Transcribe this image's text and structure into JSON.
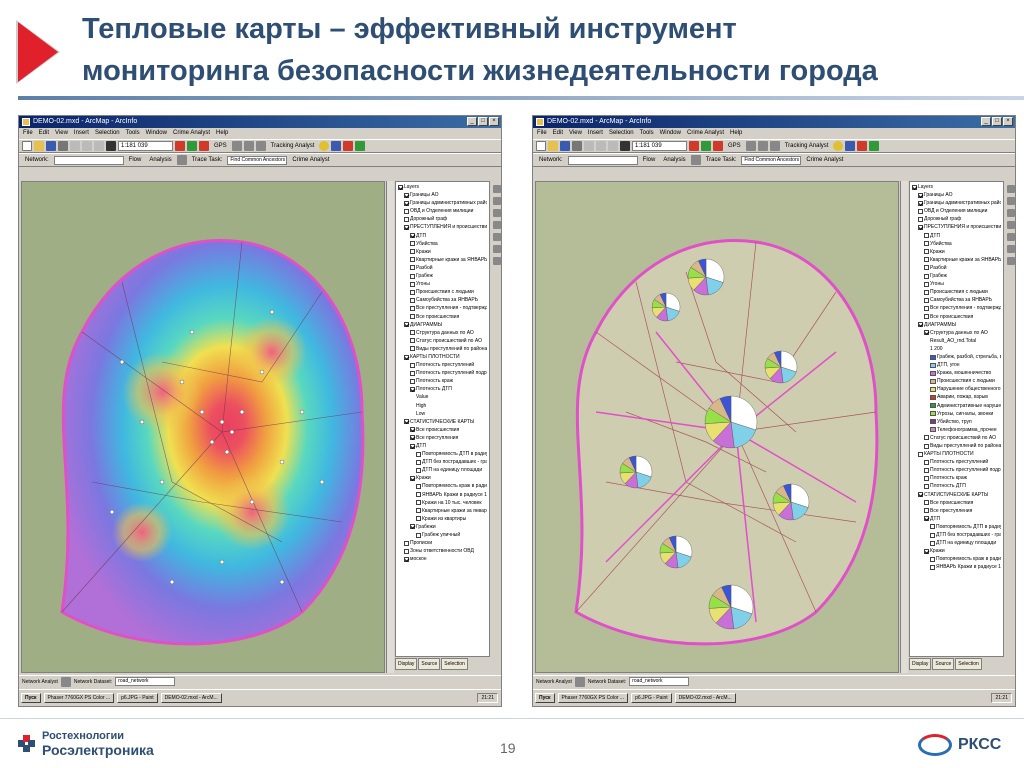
{
  "slide": {
    "title_line1": "Тепловые карты – эффективный инструмент",
    "title_line2": "мониторинга безопасности жизнедеятельности города",
    "page_number": "19",
    "logo_left_line1": "Ростехнологии",
    "logo_left_line2": "Росэлектроника",
    "logo_right": "РКСС"
  },
  "window": {
    "title": "DEMO-02.mxd - ArcMap - ArcInfo",
    "menu": [
      "File",
      "Edit",
      "View",
      "Insert",
      "Selection",
      "Tools",
      "Window",
      "Crime Analyst",
      "Help"
    ],
    "scale": "1:181 039",
    "gps_label": "GPS",
    "tracking_analyst": "Tracking Analyst",
    "network_label": "Network:",
    "flow_label": "Flow",
    "analysis_label": "Analysis",
    "trace_task_label": "Trace Task:",
    "trace_task_value": "Find Common Ancestors",
    "crime_analyst": "Crime Analyst",
    "network_analyst": "Network Analyst",
    "network_dataset_label": "Network Dataset:",
    "network_dataset_value": "road_network",
    "toc_tabs": [
      "Display",
      "Source",
      "Selection"
    ],
    "taskbar": {
      "start": "Пуск",
      "tasks_left": [
        "Phaser 7760GX PS Color ...",
        "p6.JPG - Paint",
        "DEMO-02.mxd - ArcM..."
      ],
      "tasks_right": [
        "Phaser 7760GX PS Color ...",
        "p6.JPG - Paint",
        "DEMO-02.mxd - ArcM..."
      ],
      "clock": "21:21"
    }
  },
  "toc_left": [
    {
      "t": "Layers",
      "lvl": 0,
      "c": true
    },
    {
      "t": "Границы АО",
      "lvl": 1,
      "c": true
    },
    {
      "t": "Границы административных районов",
      "lvl": 1,
      "c": true
    },
    {
      "t": "ОВД и Отделения милиции",
      "lvl": 1,
      "c": false
    },
    {
      "t": "Дорожный граф",
      "lvl": 1,
      "c": false
    },
    {
      "t": "ПРЕСТУПЛЕНИЯ и происшествия",
      "lvl": 1,
      "c": true
    },
    {
      "t": "ДТП",
      "lvl": 2,
      "c": true
    },
    {
      "t": "Убийства",
      "lvl": 2,
      "c": false
    },
    {
      "t": "Кражи",
      "lvl": 2,
      "c": false
    },
    {
      "t": "Квартирные кражи за ЯНВАРЬ",
      "lvl": 2,
      "c": false
    },
    {
      "t": "Разбой",
      "lvl": 2,
      "c": false
    },
    {
      "t": "Грабеж",
      "lvl": 2,
      "c": false
    },
    {
      "t": "Угоны",
      "lvl": 2,
      "c": false
    },
    {
      "t": "Происшествия с людьми",
      "lvl": 2,
      "c": false
    },
    {
      "t": "Самоубийства за ЯНВАРЬ",
      "lvl": 2,
      "c": false
    },
    {
      "t": "Все преступления - подтвержденные",
      "lvl": 2,
      "c": false
    },
    {
      "t": "Все происшествия",
      "lvl": 2,
      "c": false
    },
    {
      "t": "ДИАГРАММЫ",
      "lvl": 1,
      "c": true
    },
    {
      "t": "Структура данных по АО",
      "lvl": 2,
      "c": false
    },
    {
      "t": "Статус происшествий по АО",
      "lvl": 2,
      "c": false
    },
    {
      "t": "Виды преступлений по районам",
      "lvl": 2,
      "c": false
    },
    {
      "t": "КАРТЫ ПЛОТНОСТИ",
      "lvl": 1,
      "c": true
    },
    {
      "t": "Плотность преступлений",
      "lvl": 2,
      "c": false
    },
    {
      "t": "Плотность преступлений подробная",
      "lvl": 2,
      "c": false
    },
    {
      "t": "Плотность краж",
      "lvl": 2,
      "c": false
    },
    {
      "t": "Плотность ДТП",
      "lvl": 2,
      "c": true
    },
    {
      "t": "Value",
      "lvl": 3,
      "c": null
    },
    {
      "t": "High",
      "lvl": 3,
      "c": null
    },
    {
      "t": "",
      "lvl": 3,
      "c": null
    },
    {
      "t": "Low",
      "lvl": 3,
      "c": null
    },
    {
      "t": "СТАТИСТИЧЕСКИЕ КАРТЫ",
      "lvl": 1,
      "c": true
    },
    {
      "t": "Все происшествия",
      "lvl": 2,
      "c": true
    },
    {
      "t": "Все преступления",
      "lvl": 2,
      "c": true
    },
    {
      "t": "ДТП",
      "lvl": 2,
      "c": true
    },
    {
      "t": "Повторяемость ДТП в радиусе 100",
      "lvl": 3,
      "c": false
    },
    {
      "t": "ДТП без пострадавших - градуир...",
      "lvl": 3,
      "c": false
    },
    {
      "t": "ДТП на единицу площади",
      "lvl": 3,
      "c": false
    },
    {
      "t": "Кражи",
      "lvl": 2,
      "c": true
    },
    {
      "t": "Повторяемость краж в радиусе 10",
      "lvl": 3,
      "c": false
    },
    {
      "t": "ЯНВАРЬ Кражи в радиусе 1 км",
      "lvl": 3,
      "c": false
    },
    {
      "t": "Кражи на 10 тыс. человек",
      "lvl": 3,
      "c": false
    },
    {
      "t": "Квартирные кражи за январь",
      "lvl": 3,
      "c": false
    },
    {
      "t": "Кражи из квартиры",
      "lvl": 3,
      "c": false
    },
    {
      "t": "Грабежи",
      "lvl": 2,
      "c": true
    },
    {
      "t": "Грабеж уличный",
      "lvl": 3,
      "c": false
    },
    {
      "t": "Прописки",
      "lvl": 1,
      "c": false
    },
    {
      "t": "Зоны ответственности ОВД",
      "lvl": 1,
      "c": false
    },
    {
      "t": "москон",
      "lvl": 1,
      "c": true
    }
  ],
  "toc_right": [
    {
      "t": "Layers",
      "lvl": 0,
      "c": true
    },
    {
      "t": "Границы АО",
      "lvl": 1,
      "c": true
    },
    {
      "t": "Границы административных районов",
      "lvl": 1,
      "c": true
    },
    {
      "t": "ОВД и Отделения милиции",
      "lvl": 1,
      "c": false
    },
    {
      "t": "Дорожный граф",
      "lvl": 1,
      "c": false
    },
    {
      "t": "ПРЕСТУПЛЕНИЯ и происшествия",
      "lvl": 1,
      "c": true
    },
    {
      "t": "ДТП",
      "lvl": 2,
      "c": false
    },
    {
      "t": "Убийства",
      "lvl": 2,
      "c": false
    },
    {
      "t": "Кражи",
      "lvl": 2,
      "c": false
    },
    {
      "t": "Квартирные кражи за ЯНВАРЬ",
      "lvl": 2,
      "c": false
    },
    {
      "t": "Разбой",
      "lvl": 2,
      "c": false
    },
    {
      "t": "Грабеж",
      "lvl": 2,
      "c": false
    },
    {
      "t": "Угоны",
      "lvl": 2,
      "c": false
    },
    {
      "t": "Происшествия с людьми",
      "lvl": 2,
      "c": false
    },
    {
      "t": "Самоубийства за ЯНВАРЬ",
      "lvl": 2,
      "c": false
    },
    {
      "t": "Все преступления - подтвержденные",
      "lvl": 2,
      "c": false
    },
    {
      "t": "Все происшествия",
      "lvl": 2,
      "c": false
    },
    {
      "t": "ДИАГРАММЫ",
      "lvl": 1,
      "c": true
    },
    {
      "t": "Структура данных по АО",
      "lvl": 2,
      "c": true
    },
    {
      "t": "Result_AO_rnd.Total",
      "lvl": 3,
      "c": null
    },
    {
      "t": "",
      "lvl": 3,
      "c": null
    },
    {
      "t": "1 200",
      "lvl": 3,
      "c": null
    },
    {
      "t": "",
      "lvl": 3,
      "c": null
    },
    {
      "t": "Грабеж, разбой, стрельба, взрыв",
      "lvl": 3,
      "c": null,
      "sw": "#3b55d6"
    },
    {
      "t": "ДТП, угон",
      "lvl": 3,
      "c": null,
      "sw": "#7fd0e8"
    },
    {
      "t": "Кража, мошенничество",
      "lvl": 3,
      "c": null,
      "sw": "#c86fd8"
    },
    {
      "t": "Происшествия с людьми",
      "lvl": 3,
      "c": null,
      "sw": "#d8b88a"
    },
    {
      "t": "Нарушение общественного пор",
      "lvl": 3,
      "c": null,
      "sw": "#e8e070"
    },
    {
      "t": "Аварии, пожар, взрыв",
      "lvl": 3,
      "c": null,
      "sw": "#d03a2a"
    },
    {
      "t": "Административные нарушения",
      "lvl": 3,
      "c": null,
      "sw": "#2f9a3a"
    },
    {
      "t": "Угрозы, сигналы, звонки",
      "lvl": 3,
      "c": null,
      "sw": "#98e048"
    },
    {
      "t": "Убийство, труп",
      "lvl": 3,
      "c": null,
      "sw": "#7a3a8a"
    },
    {
      "t": "Телефонограмма_прочее",
      "lvl": 3,
      "c": null,
      "sw": "#c890b8"
    },
    {
      "t": "Статус происшествий по АО",
      "lvl": 2,
      "c": false
    },
    {
      "t": "Виды преступлений по районам",
      "lvl": 2,
      "c": false
    },
    {
      "t": "КАРТЫ ПЛОТНОСТИ",
      "lvl": 1,
      "c": false
    },
    {
      "t": "Плотность преступлений",
      "lvl": 2,
      "c": false
    },
    {
      "t": "Плотность преступлений подробна",
      "lvl": 2,
      "c": false
    },
    {
      "t": "Плотность краж",
      "lvl": 2,
      "c": false
    },
    {
      "t": "Плотность ДТП",
      "lvl": 2,
      "c": false
    },
    {
      "t": "СТАТИСТИЧЕСКИЕ КАРТЫ",
      "lvl": 1,
      "c": true
    },
    {
      "t": "Все происшествия",
      "lvl": 2,
      "c": false
    },
    {
      "t": "Все преступления",
      "lvl": 2,
      "c": false
    },
    {
      "t": "ДТП",
      "lvl": 2,
      "c": true
    },
    {
      "t": "Повторяемость ДТП в радиусе",
      "lvl": 3,
      "c": false
    },
    {
      "t": "ДТП без пострадавших - градуир",
      "lvl": 3,
      "c": false
    },
    {
      "t": "ДТП на единицу площади",
      "lvl": 3,
      "c": false
    },
    {
      "t": "Кражи",
      "lvl": 2,
      "c": true
    },
    {
      "t": "Повторяемость краж в радиусе 1",
      "lvl": 3,
      "c": false
    },
    {
      "t": "ЯНВАРЬ Кражи в радиусе 1 км",
      "lvl": 3,
      "c": false
    }
  ],
  "colors": {
    "title": "#2e4e74",
    "accent_red": "#e0202a",
    "boundary_pink": "#e050c8",
    "heat_low": "#7070d8",
    "heat_mid": "#38c8e0",
    "heat_high": "#e84040"
  },
  "icons": [
    "play-arrow-icon",
    "save-icon",
    "print-icon",
    "zoom-in-icon",
    "pan-icon",
    "identify-icon",
    "layers-icon"
  ]
}
